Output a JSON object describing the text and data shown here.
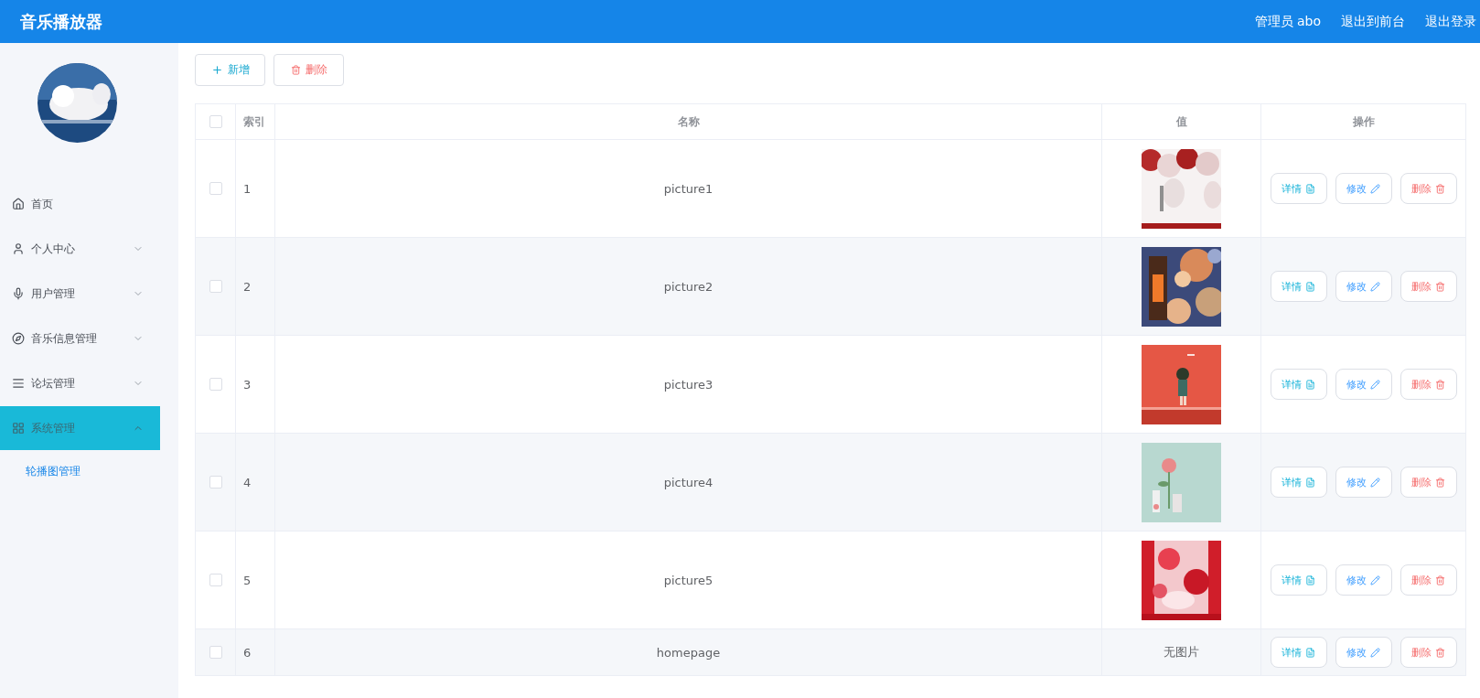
{
  "header": {
    "title": "音乐播放器",
    "user": "管理员 abo",
    "links": [
      "退出到前台",
      "退出登录"
    ]
  },
  "sidebar": {
    "avatar": {
      "kind": "picture"
    },
    "items": [
      {
        "label": "首页",
        "kind": "link",
        "selected": false
      },
      {
        "label": "个人中心",
        "kind": "group",
        "selected": false,
        "expanded": false
      },
      {
        "label": "用户管理",
        "kind": "group",
        "selected": false,
        "expanded": false
      },
      {
        "label": "音乐信息管理",
        "kind": "group",
        "selected": false,
        "expanded": false
      },
      {
        "label": "论坛管理",
        "kind": "group",
        "selected": false,
        "expanded": false
      },
      {
        "label": "系统管理",
        "kind": "group",
        "selected": true,
        "expanded": true,
        "children": [
          {
            "label": "轮播图管理",
            "selected": true
          }
        ]
      }
    ]
  },
  "toolbar": [
    {
      "label": "新增",
      "kind": "add"
    },
    {
      "label": "删除",
      "kind": "delete"
    }
  ],
  "table": {
    "all_checked": false,
    "columns": [
      "索引",
      "名称",
      "值",
      "操作"
    ],
    "rows": [
      {
        "checked": false,
        "index": "1",
        "name": "picture1",
        "value": {
          "kind": "picture"
        },
        "actions": [
          {
            "label": "详情",
            "kind": "detail"
          },
          {
            "label": "修改",
            "kind": "edit"
          },
          {
            "label": "删除",
            "kind": "delete"
          }
        ]
      },
      {
        "checked": false,
        "index": "2",
        "name": "picture2",
        "value": {
          "kind": "picture"
        },
        "actions": [
          {
            "label": "详情",
            "kind": "detail"
          },
          {
            "label": "修改",
            "kind": "edit"
          },
          {
            "label": "删除",
            "kind": "delete"
          }
        ]
      },
      {
        "checked": false,
        "index": "3",
        "name": "picture3",
        "value": {
          "kind": "picture"
        },
        "actions": [
          {
            "label": "详情",
            "kind": "detail"
          },
          {
            "label": "修改",
            "kind": "edit"
          },
          {
            "label": "删除",
            "kind": "delete"
          }
        ]
      },
      {
        "checked": false,
        "index": "4",
        "name": "picture4",
        "value": {
          "kind": "picture"
        },
        "actions": [
          {
            "label": "详情",
            "kind": "detail"
          },
          {
            "label": "修改",
            "kind": "edit"
          },
          {
            "label": "删除",
            "kind": "delete"
          }
        ]
      },
      {
        "checked": false,
        "index": "5",
        "name": "picture5",
        "value": {
          "kind": "picture"
        },
        "actions": [
          {
            "label": "详情",
            "kind": "detail"
          },
          {
            "label": "修改",
            "kind": "edit"
          },
          {
            "label": "删除",
            "kind": "delete"
          }
        ]
      },
      {
        "checked": false,
        "index": "6",
        "name": "homepage",
        "value": {
          "kind": "text",
          "text": "无图片"
        },
        "actions": [
          {
            "label": "详情",
            "kind": "detail"
          },
          {
            "label": "修改",
            "kind": "edit"
          },
          {
            "label": "删除",
            "kind": "delete"
          }
        ]
      }
    ]
  }
}
